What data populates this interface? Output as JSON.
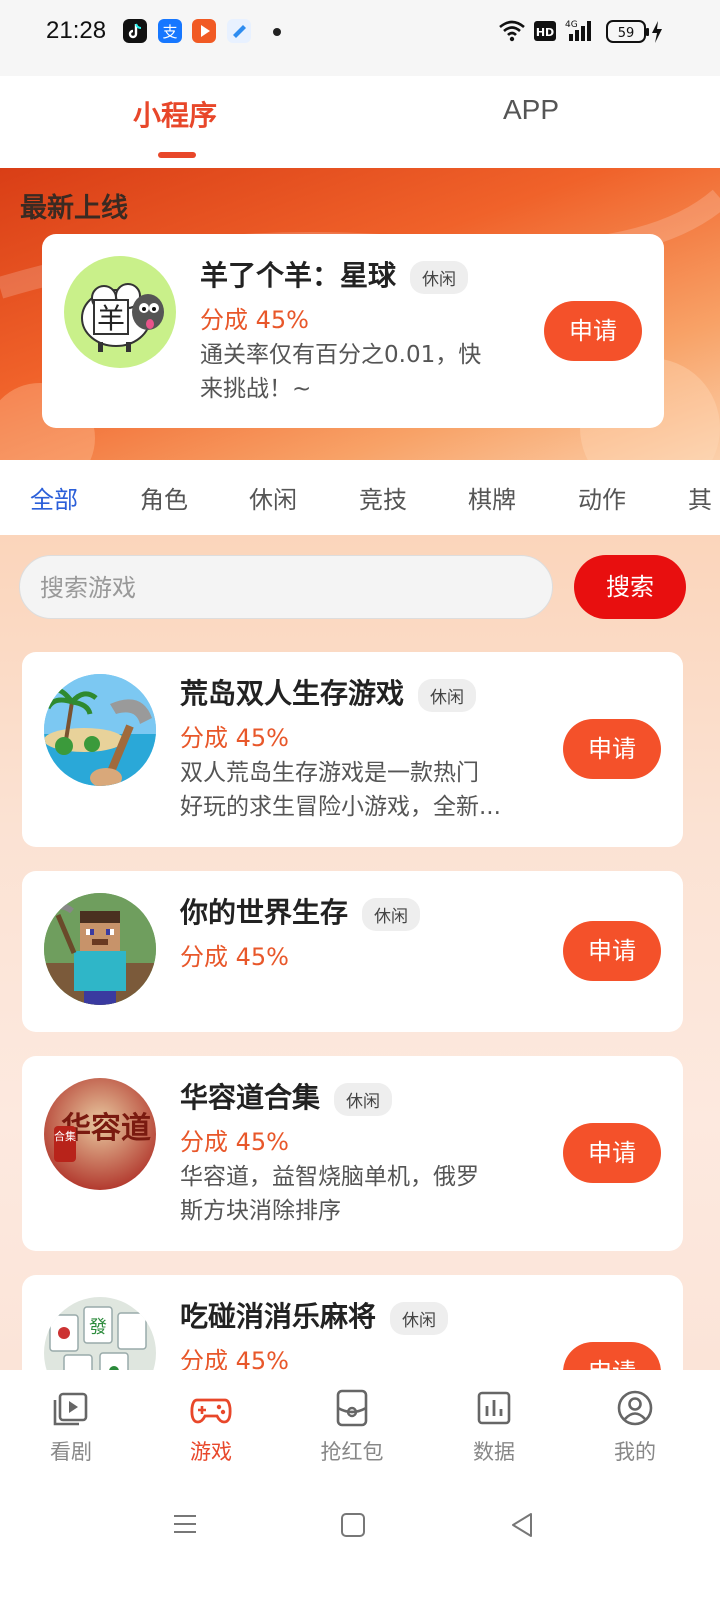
{
  "status_bar": {
    "time": "21:28",
    "battery": "59",
    "network": "4G",
    "hd": "HD"
  },
  "top_tabs": [
    {
      "label": "小程序",
      "active": true
    },
    {
      "label": "APP",
      "active": false
    }
  ],
  "banner": {
    "title": "最新上线",
    "featured": {
      "name": "羊了个羊：星球",
      "tag": "休闲",
      "share": "分成 45%",
      "desc_line1": "通关率仅有百分之0.01，快",
      "desc_line2": "来挑战！~",
      "apply": "申请",
      "avatar_text": "羊"
    }
  },
  "categories": [
    "全部",
    "角色",
    "休闲",
    "竞技",
    "棋牌",
    "动作",
    "其"
  ],
  "search": {
    "placeholder": "搜索游戏",
    "button": "搜索"
  },
  "games": [
    {
      "name": "荒岛双人生存游戏",
      "tag": "休闲",
      "share": "分成 45%",
      "desc_line1": "双人荒岛生存游戏是一款热门",
      "desc_line2": "好玩的求生冒险小游戏，全新...",
      "apply": "申请"
    },
    {
      "name": "你的世界生存",
      "tag": "休闲",
      "share": "分成 45%",
      "apply": "申请"
    },
    {
      "name": "华容道合集",
      "tag": "休闲",
      "share": "分成 45%",
      "desc_line1": "华容道，益智烧脑单机，俄罗",
      "desc_line2": "斯方块消除排序",
      "apply": "申请",
      "avatar_text": "华容道",
      "avatar_badge": "合集"
    },
    {
      "name": "吃碰消消乐麻将",
      "tag": "休闲",
      "share": "分成 45%",
      "apply": "申请",
      "avatar_text": "發"
    }
  ],
  "nav": [
    {
      "label": "看剧",
      "icon": "play-icon",
      "active": false
    },
    {
      "label": "游戏",
      "icon": "gamepad-icon",
      "active": true
    },
    {
      "label": "抢红包",
      "icon": "red-packet-icon",
      "active": false
    },
    {
      "label": "数据",
      "icon": "chart-icon",
      "active": false
    },
    {
      "label": "我的",
      "icon": "user-icon",
      "active": false
    }
  ],
  "colors": {
    "accent": "#e8472a",
    "apply_button": "#f4512a",
    "search_button": "#e80f0f",
    "category_active": "#2b5fd9"
  }
}
